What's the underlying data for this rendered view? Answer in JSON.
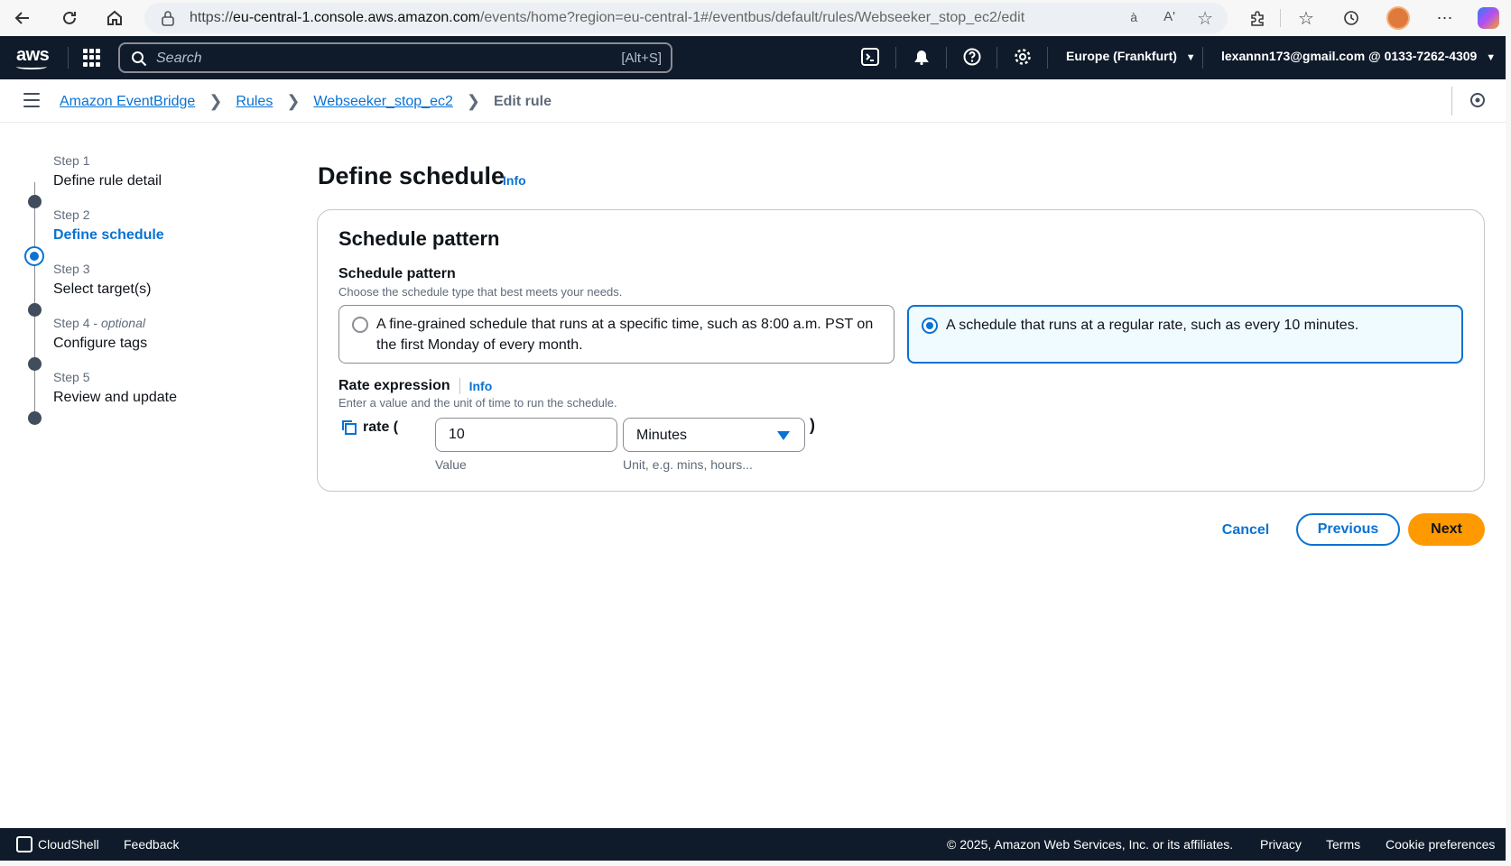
{
  "browser": {
    "url_prefix": "https://",
    "url_host": "eu-central-1.console.aws.amazon.com",
    "url_path": "/events/home?region=eu-central-1#/eventbus/default/rules/Webseeker_stop_ec2/edit"
  },
  "aws_nav": {
    "logo": "aws",
    "search_placeholder": "Search",
    "search_shortcut": "[Alt+S]",
    "region": "Europe (Frankfurt)",
    "account": "lexannn173@gmail.com @ 0133-7262-4309"
  },
  "breadcrumbs": {
    "items": [
      "Amazon EventBridge",
      "Rules",
      "Webseeker_stop_ec2"
    ],
    "current": "Edit rule"
  },
  "steps": [
    {
      "label": "Step 1",
      "optional": "",
      "name": "Define rule detail",
      "active": false
    },
    {
      "label": "Step 2",
      "optional": "",
      "name": "Define schedule",
      "active": true
    },
    {
      "label": "Step 3",
      "optional": "",
      "name": "Select target(s)",
      "active": false
    },
    {
      "label": "Step 4",
      "optional": "optional",
      "name": "Configure tags",
      "active": false
    },
    {
      "label": "Step 5",
      "optional": "",
      "name": "Review and update",
      "active": false
    }
  ],
  "main": {
    "title": "Define schedule",
    "info": "Info",
    "panel_title": "Schedule pattern",
    "schedule_label": "Schedule pattern",
    "schedule_desc": "Choose the schedule type that best meets your needs.",
    "options": [
      {
        "text": "A fine-grained schedule that runs at a specific time, such as 8:00 a.m. PST on the first Monday of every month.",
        "selected": false
      },
      {
        "text": "A schedule that runs at a regular rate, such as every 10 minutes.",
        "selected": true
      }
    ],
    "rate_label": "Rate expression",
    "rate_info": "Info",
    "rate_desc": "Enter a value and the unit of time to run the schedule.",
    "rate_prefix": "rate (",
    "rate_suffix": ")",
    "value": "10",
    "value_caption": "Value",
    "unit": "Minutes",
    "unit_caption": "Unit, e.g. mins, hours..."
  },
  "actions": {
    "cancel": "Cancel",
    "previous": "Previous",
    "next": "Next"
  },
  "footer": {
    "cloudshell": "CloudShell",
    "feedback": "Feedback",
    "copyright": "© 2025, Amazon Web Services, Inc. or its affiliates.",
    "privacy": "Privacy",
    "terms": "Terms",
    "cookies": "Cookie preferences"
  },
  "colors": {
    "accent": "#0972d3",
    "primary_button": "#ff9900",
    "nav_bg": "#0f1b2a"
  }
}
